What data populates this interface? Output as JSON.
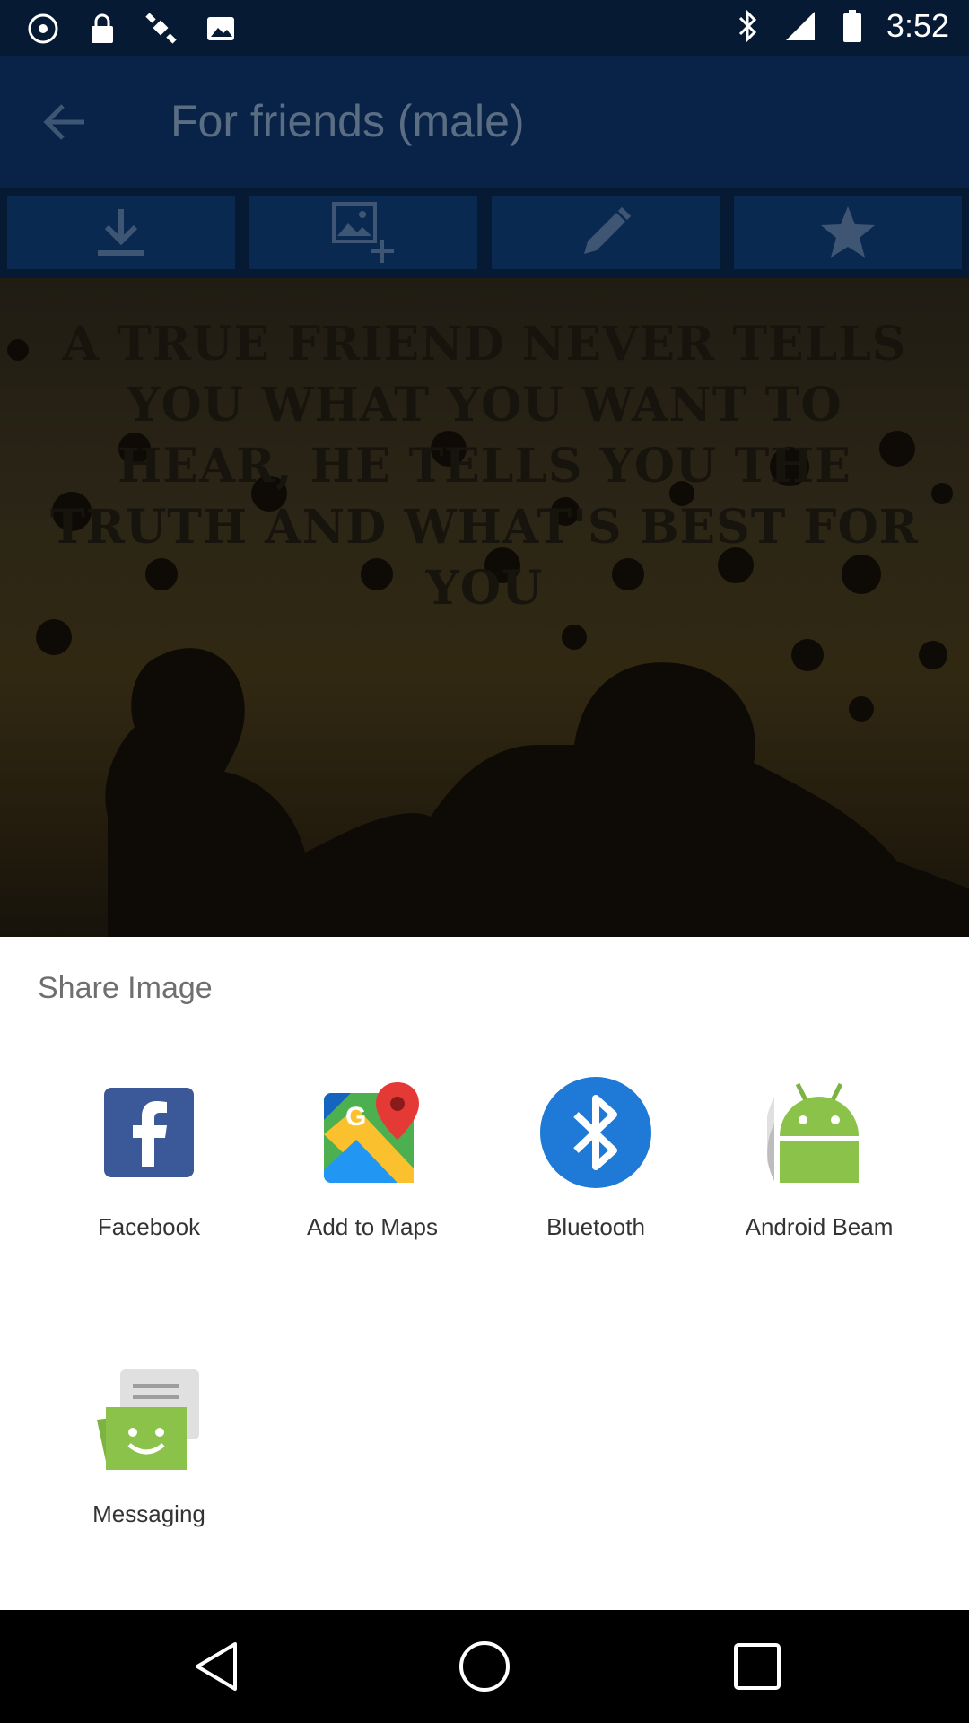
{
  "status_bar": {
    "time": "3:52",
    "icons": [
      "android-debug-icon",
      "lock-icon",
      "satellite-icon",
      "image-icon",
      "bluetooth-icon",
      "signal-icon",
      "battery-icon"
    ]
  },
  "app_bar": {
    "title": "For friends (male)",
    "back_icon": "back-arrow-icon"
  },
  "toolbar": {
    "buttons": [
      "download-icon",
      "add-image-icon",
      "edit-pencil-icon",
      "star-icon"
    ]
  },
  "image": {
    "quote": "A TRUE FRIEND NEVER TELLS YOU WHAT YOU WANT TO HEAR, HE TELLS YOU THE TRUTH AND WHAT'S BEST FOR YOU"
  },
  "share_sheet": {
    "title": "Share Image",
    "targets": [
      {
        "label": "Facebook",
        "icon": "facebook-icon"
      },
      {
        "label": "Add to Maps",
        "icon": "google-maps-icon"
      },
      {
        "label": "Bluetooth",
        "icon": "bluetooth-icon"
      },
      {
        "label": "Android Beam",
        "icon": "android-beam-icon"
      },
      {
        "label": "Messaging",
        "icon": "messaging-icon"
      }
    ]
  },
  "nav_bar": {
    "buttons": [
      "back-icon",
      "home-icon",
      "recents-icon"
    ]
  },
  "colors": {
    "status_bar_bg": "#061a33",
    "app_bar_bg": "#082347",
    "facebook_blue": "#3b5998",
    "bluetooth_blue": "#1e7ad6",
    "android_green": "#8bc34a"
  }
}
